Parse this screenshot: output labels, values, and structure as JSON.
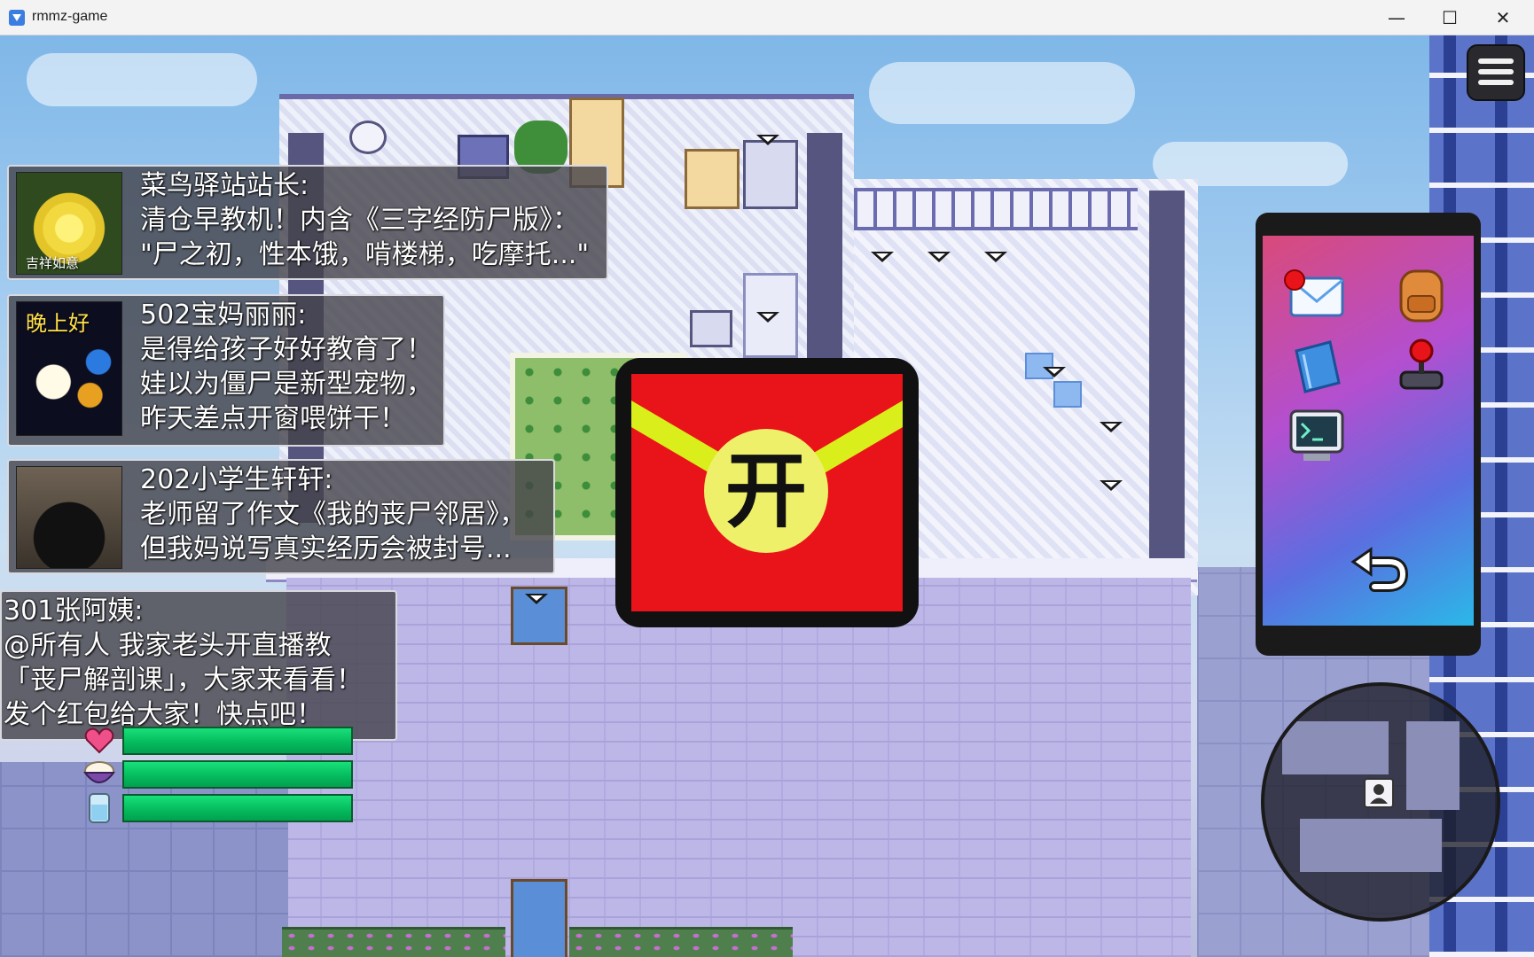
{
  "window": {
    "title": "rmmz-game",
    "controls": {
      "minimize": "—",
      "maximize": "☐",
      "close": "✕"
    }
  },
  "chat_messages": [
    {
      "sender": "菜鸟驿站站长:",
      "lines": [
        "清仓早教机！内含《三字经防尸版》：",
        "\"尸之初，性本饿，啃楼梯，吃摩托...\""
      ],
      "avatar": {
        "icon": "lotus-flower-avatar",
        "caption": "吉祥如意"
      }
    },
    {
      "sender": "502宝妈丽丽:",
      "lines": [
        "是得给孩子好好教育了！",
        "娃以为僵尸是新型宠物，",
        "昨天差点开窗喂饼干！"
      ],
      "avatar": {
        "icon": "good-evening-moon-avatar",
        "caption": "晚上好"
      }
    },
    {
      "sender": "202小学生轩轩:",
      "lines": [
        "老师留了作文《我的丧尸邻居》，",
        "但我妈说写真实经历会被封号..."
      ],
      "avatar": {
        "icon": "black-cat-avatar",
        "caption": ""
      }
    },
    {
      "sender": "301张阿姨:",
      "lines": [
        "@所有人 我家老头开直播教",
        "「丧尸解剖课」，大家来看看！",
        "发个红包给大家！快点吧！"
      ],
      "avatar": null
    }
  ],
  "red_envelope": {
    "open_label": "开",
    "colors": {
      "body": "#e8141a",
      "band": "#d9ee1a",
      "seal": "#eef06a"
    }
  },
  "phone_menu": {
    "apps": [
      {
        "id": "mail",
        "icon": "mail-icon",
        "has_notification": true
      },
      {
        "id": "bag",
        "icon": "backpack-icon",
        "has_notification": false
      },
      {
        "id": "book",
        "icon": "book-icon",
        "has_notification": false
      },
      {
        "id": "game",
        "icon": "joystick-icon",
        "has_notification": false
      },
      {
        "id": "terminal",
        "icon": "terminal-icon",
        "has_notification": false
      }
    ],
    "back_icon": "back-arrow-icon"
  },
  "hud": {
    "stats": [
      {
        "icon": "heart-icon",
        "level": 1.0
      },
      {
        "icon": "rice-bowl-icon",
        "level": 1.0
      },
      {
        "icon": "water-cup-icon",
        "level": 1.0
      }
    ],
    "menu_icon": "hamburger-menu-icon",
    "minimap_player_icon": "player-marker-icon"
  }
}
